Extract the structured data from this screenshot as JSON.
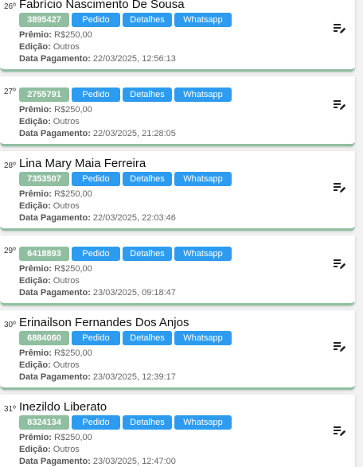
{
  "labels": {
    "premio": "Prêmio:",
    "edicao": "Edição:",
    "data_pagamento": "Data Pagamento:",
    "pedido": "Pedido",
    "detalhes": "Detalhes",
    "whatsapp": "Whatsapp"
  },
  "colors": {
    "code_badge": "#8fbea0",
    "button": "#2d9cf0",
    "card_border": "#8fbea0"
  },
  "icons": {
    "edit": "playlist-edit-icon"
  },
  "entries": [
    {
      "rank": "26º",
      "name": "Fabrício Nascimento De Sousa",
      "code": "3895427",
      "premio": "R$250,00",
      "edicao": "Outros",
      "data": "22/03/2025, 12:56:13"
    },
    {
      "rank": "27º",
      "name": "",
      "code": "2755791",
      "premio": "R$250,00",
      "edicao": "Outros",
      "data": "22/03/2025, 21:28:05"
    },
    {
      "rank": "28º",
      "name": "Lina Mary Maia Ferreira",
      "code": "7353507",
      "premio": "R$250,00",
      "edicao": "Outros",
      "data": "22/03/2025, 22:03:46"
    },
    {
      "rank": "29º",
      "name": "",
      "code": "6418893",
      "premio": "R$250,00",
      "edicao": "Outros",
      "data": "23/03/2025, 09:18:47"
    },
    {
      "rank": "30º",
      "name": "Erinailson Fernandes Dos Anjos",
      "code": "6884060",
      "premio": "R$250,00",
      "edicao": "Outros",
      "data": "23/03/2025, 12:39:17"
    },
    {
      "rank": "31º",
      "name": "Inezildo Liberato",
      "code": "8324134",
      "premio": "R$250,00",
      "edicao": "Outros",
      "data": "23/03/2025, 12:47:00"
    }
  ]
}
